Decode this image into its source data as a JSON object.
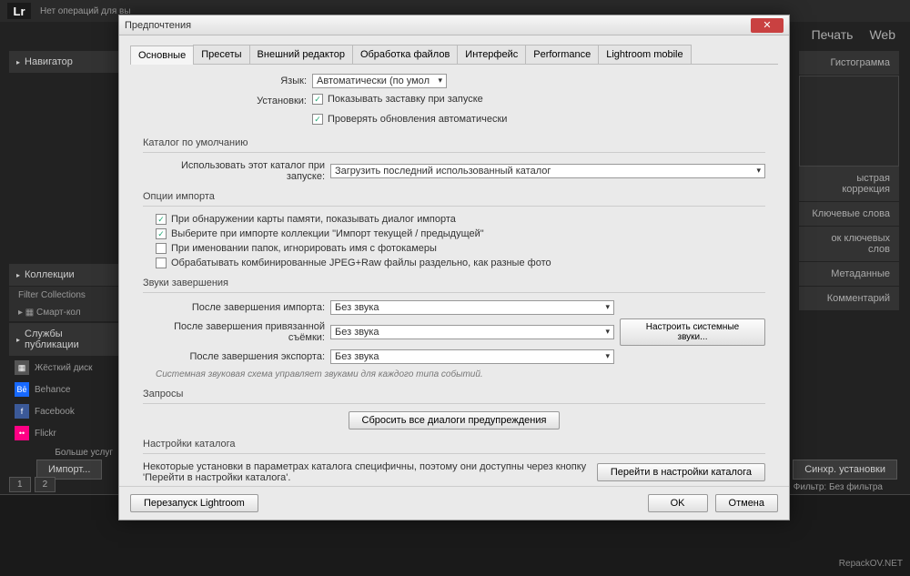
{
  "topbar": {
    "logo": "Lr",
    "status": "Нет операций для вы"
  },
  "modules": {
    "print": "Печать",
    "web": "Web"
  },
  "navigator": {
    "title": "Навигатор"
  },
  "collections": {
    "title": "Коллекции",
    "filter": "Filter Collections",
    "smart": "Смарт-кол"
  },
  "services": {
    "title": "Службы публикации",
    "hd": "Жёсткий диск",
    "be": "Behance",
    "fb": "Facebook",
    "fl": "Flickr",
    "more": "Больше услуг"
  },
  "import_btn": "Импорт...",
  "right_panel": {
    "histogram": "Гистограмма",
    "quick": "ыстрая коррекция",
    "keywords": "Ключевые слова",
    "keylist": "ок ключевых слов",
    "metadata": "Метаданные",
    "comments": "Комментарий"
  },
  "sync": "Синхр. установки",
  "filter_label": "Фильтр:",
  "filter_value": "Без фильтра",
  "watermark": "RepackOV.NET",
  "dialog": {
    "title": "Предпочтения",
    "tabs": {
      "general": "Основные",
      "presets": "Пресеты",
      "external": "Внешний редактор",
      "files": "Обработка файлов",
      "interface": "Интерфейс",
      "performance": "Performance",
      "mobile": "Lightroom mobile"
    },
    "language_label": "Язык:",
    "language_value": "Автоматически (по умол",
    "settings_label": "Установки:",
    "show_splash": "Показывать заставку при запуске",
    "check_updates": "Проверять обновления автоматически",
    "catalog_section": "Каталог по умолчанию",
    "catalog_label": "Использовать этот каталог при запуске:",
    "catalog_value": "Загрузить последний использованный каталог",
    "import_section": "Опции импорта",
    "import_opt1": "При обнаружении карты памяти, показывать диалог импорта",
    "import_opt2": "Выберите при импорте коллекции \"Импорт текущей / предыдущей\"",
    "import_opt3": "При именовании папок, игнорировать имя с фотокамеры",
    "import_opt4": "Обрабатывать комбинированные JPEG+Raw файлы раздельно, как разные фото",
    "sounds_section": "Звуки завершения",
    "sound_import_label": "После завершения импорта:",
    "sound_tether_label": "После завершения привязанной съёмки:",
    "sound_export_label": "После завершения экспорта:",
    "sound_value": "Без звука",
    "sound_btn": "Настроить системные звуки...",
    "sound_hint": "Системная звуковая схема управляет звуками для каждого типа событий.",
    "requests_section": "Запросы",
    "reset_warnings": "Сбросить все диалоги предупреждения",
    "catalog_settings_section": "Настройки каталога",
    "catalog_settings_text": "Некоторые установки в параметрах каталога специфичны, поэтому они доступны через кнопку 'Перейти в настройки каталога'.",
    "catalog_settings_btn": "Перейти в настройки каталога",
    "restart": "Перезапуск Lightroom",
    "ok": "OK",
    "cancel": "Отмена"
  }
}
